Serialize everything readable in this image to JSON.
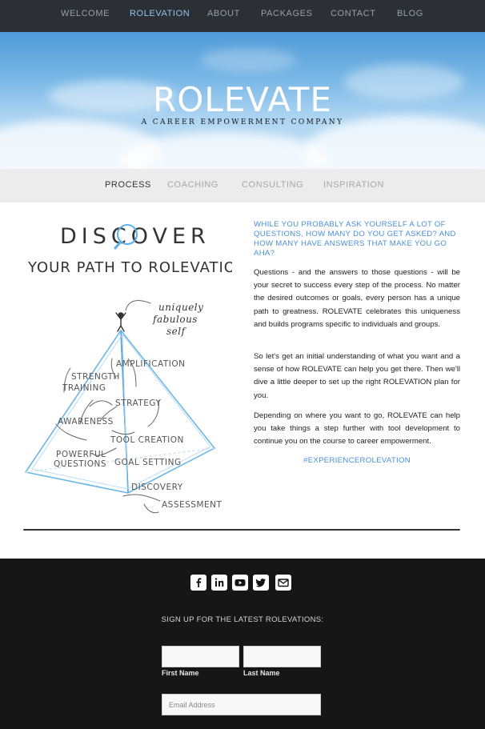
{
  "nav": {
    "items": [
      "WELCOME",
      "ROLEVATION",
      "ABOUT",
      "PACKAGES",
      "CONTACT",
      "BLOG"
    ],
    "active": "ROLEVATION"
  },
  "hero": {
    "title": "ROLEVATE",
    "subtitle": "A CAREER EMPOWERMENT COMPANY"
  },
  "subnav": {
    "items": [
      "PROCESS",
      "COACHING",
      "CONSULTING",
      "INSPIRATION"
    ],
    "active": "PROCESS"
  },
  "illustration": {
    "heading": "DISCOVER",
    "subheading": "YOUR PATH TO ROLEVATION",
    "labels": {
      "top": "uniquely fabulous self",
      "amplification": "AMPLIFICATION",
      "strength": "STRENGTH TRAINING",
      "strategy": "STRATEGY",
      "awareness": "AWARENESS",
      "tool": "TOOL CREATION",
      "powerful": "POWERFUL QUESTIONS",
      "goal": "GOAL SETTING",
      "discovery": "DISCOVERY",
      "assessment": "ASSESSMENT"
    }
  },
  "content": {
    "intro": "WHILE YOU PROBABLY ASK YOURSELF A LOT OF QUESTIONS, HOW MANY DO YOU GET ASKED? AND HOW MANY HAVE ANSWERS THAT MAKE YOU GO AHA?",
    "p1": "Questions - and the answers to those questions - will be your secret to success every step of the process. No matter the desired outcomes or goals, every person has a unique path to greatness. ROLEVATE celebrates this uniqueness and builds programs specific to individuals and groups.",
    "p2": "So let's get an initial understanding of what you want and a sense of how ROLEVATE can help you get there. Then we'll dive a little deeper to set up the right ROLEVATION plan for you.",
    "p3": "Depending on where you want to go, ROLEVATE can help you take things a step further with tool development to continue you on the course to career empowerment.",
    "hashtag": "#EXPERIENCEROLEVATION"
  },
  "footer": {
    "social": [
      "facebook-icon",
      "linkedin-icon",
      "youtube-icon",
      "twitter-icon",
      "email-icon"
    ],
    "signup_heading": "SIGN UP FOR THE LATEST ROLEVATIONS:",
    "first_name_label": "First Name",
    "last_name_label": "Last Name",
    "first_name_value": "",
    "last_name_value": "",
    "email_placeholder": "Email Address"
  },
  "colors": {
    "accent_blue": "#4a8fd8",
    "nav_active": "#8fc4f0",
    "footer_bg": "#161616"
  }
}
